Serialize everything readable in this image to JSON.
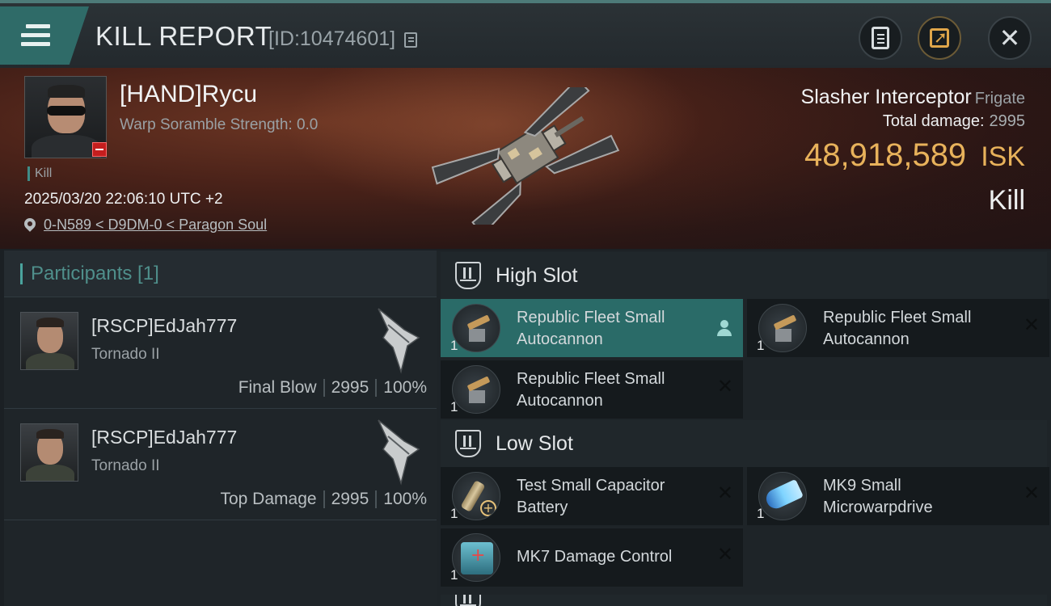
{
  "header": {
    "title": "KILL REPORT",
    "report_id": "[ID:10474601]"
  },
  "victim": {
    "pilot_name": "[HAND]Rycu",
    "scramble_strength": "Warp Soramble Strength: 0.0",
    "tag": "Kill",
    "datetime": "2025/03/20 22:06:10 UTC +2",
    "location": "0-N589 < D9DM-0 < Paragon Soul",
    "ship_name": "Slasher Interceptor",
    "ship_class": "Frigate",
    "total_damage_label": "Total damage:",
    "total_damage": "2995",
    "isk_value": "48,918,589",
    "isk_unit": "ISK",
    "result": "Kill"
  },
  "participants": {
    "label": "Participants [1]",
    "items": [
      {
        "name": "[RSCP]EdJah777",
        "ship": "Tornado II",
        "role": "Final Blow",
        "damage": "2995",
        "percent": "100%"
      },
      {
        "name": "[RSCP]EdJah777",
        "ship": "Tornado II",
        "role": "Top Damage",
        "damage": "2995",
        "percent": "100%"
      }
    ]
  },
  "fitting": {
    "high_slot": {
      "label": "High Slot",
      "modules": [
        {
          "line1": "Republic Fleet Small",
          "line2": "Autocannon",
          "qty": "1"
        },
        {
          "line1": "Republic Fleet Small",
          "line2": "Autocannon",
          "qty": "1"
        },
        {
          "line1": "Republic Fleet Small",
          "line2": "Autocannon",
          "qty": "1"
        }
      ]
    },
    "low_slot": {
      "label": "Low Slot",
      "modules": [
        {
          "line1": "Test Small Capacitor",
          "line2": "Battery",
          "qty": "1"
        },
        {
          "line1": "MK9 Small",
          "line2": "Microwarpdrive",
          "qty": "1"
        },
        {
          "line1": "MK7 Damage Control",
          "qty": "1"
        }
      ]
    }
  },
  "icons": {
    "menu": "hamburger-menu-icon",
    "copy": "copy-icon",
    "clipboard": "clipboard-icon",
    "share": "share-export-icon",
    "close": "close-icon",
    "location": "location-pin-icon",
    "slot": "slot-shield-icon",
    "pilot": "pilot-person-icon",
    "remove": "remove-x-icon"
  },
  "colors": {
    "accent_teal": "#2f6b68",
    "isk_gold": "#e8b25b",
    "negative_red": "#c41e1e"
  }
}
